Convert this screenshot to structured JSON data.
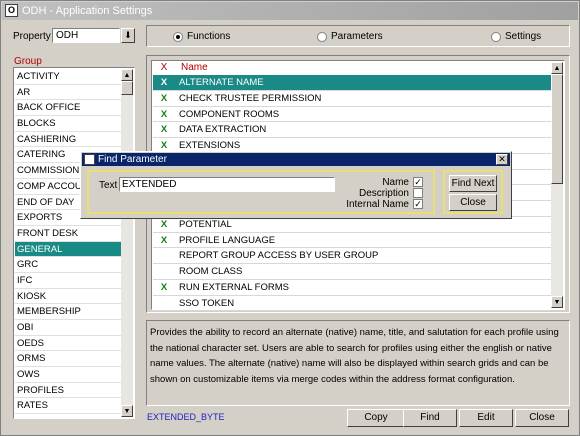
{
  "window": {
    "title": "ODH - Application Settings",
    "app_icon": "opera-icon"
  },
  "property": {
    "label": "Property",
    "value": "ODH"
  },
  "view_options": [
    {
      "label": "Functions",
      "selected": true
    },
    {
      "label": "Parameters",
      "selected": false
    },
    {
      "label": "Settings",
      "selected": false
    }
  ],
  "group": {
    "header": "Group",
    "items": [
      "ACTIVITY",
      "AR",
      "BACK OFFICE",
      "BLOCKS",
      "CASHIERING",
      "CATERING",
      "COMMISSION",
      "COMP ACCOUI",
      "END OF DAY",
      "EXPORTS",
      "FRONT DESK",
      "GENERAL",
      "GRC",
      "IFC",
      "KIOSK",
      "MEMBERSHIP",
      "OBI",
      "OEDS",
      "ORMS",
      "OWS",
      "PROFILES",
      "RATES"
    ],
    "selected": "GENERAL"
  },
  "functions": {
    "col_x": "X",
    "col_name": "Name",
    "rows": [
      {
        "x": "X",
        "name": "ALTERNATE NAME",
        "selected": true
      },
      {
        "x": "X",
        "name": "CHECK TRUSTEE PERMISSION"
      },
      {
        "x": "X",
        "name": "COMPONENT ROOMS"
      },
      {
        "x": "X",
        "name": "DATA EXTRACTION"
      },
      {
        "x": "X",
        "name": "EXTENSIONS"
      },
      {
        "x": "",
        "name": ""
      },
      {
        "x": "",
        "name": ""
      },
      {
        "x": "",
        "name": ""
      },
      {
        "x": "",
        "name": ""
      },
      {
        "x": "X",
        "name": "POTENTIAL"
      },
      {
        "x": "X",
        "name": "PROFILE LANGUAGE"
      },
      {
        "x": "",
        "name": "REPORT GROUP ACCESS BY USER GROUP"
      },
      {
        "x": "",
        "name": "ROOM CLASS"
      },
      {
        "x": "X",
        "name": "RUN EXTERNAL FORMS"
      },
      {
        "x": "",
        "name": "SSO TOKEN"
      }
    ]
  },
  "description": "Provides the ability to record an alternate (native) name, title, and salutation for each profile using the national character set. Users are able to search for profiles using either the english or native name values. The alternate (native) name will also be displayed within search grids and can be shown on customizable items via merge codes within the address format configuration.",
  "flag_name": "EXTENDED_BYTE",
  "buttons": {
    "copy": "Copy",
    "find": "Find",
    "edit": "Edit",
    "close": "Close"
  },
  "find_dialog": {
    "title": "Find Parameter",
    "text_label": "Text",
    "text_value": "EXTENDED",
    "options": [
      {
        "label": "Name",
        "checked": true
      },
      {
        "label": "Description",
        "checked": false
      },
      {
        "label": "Internal Name",
        "checked": true
      }
    ],
    "find_next": "Find Next",
    "close": "Close",
    "checkmark": "✓"
  }
}
